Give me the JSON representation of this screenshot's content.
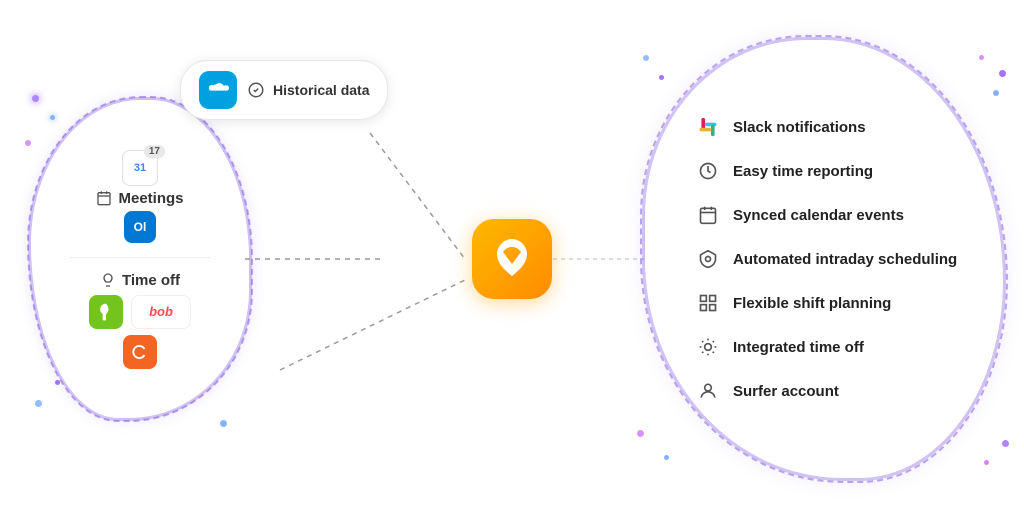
{
  "left": {
    "meetings": {
      "label": "Meetings",
      "badge": "17"
    },
    "timeoff": {
      "label": "Time off"
    }
  },
  "historical": {
    "label": "Historical data"
  },
  "features": [
    {
      "id": "slack-notifications",
      "icon": "slack",
      "text": "Slack notifications"
    },
    {
      "id": "easy-time-reporting",
      "icon": "clock",
      "text": "Easy time reporting"
    },
    {
      "id": "synced-calendar",
      "icon": "calendar",
      "text": "Synced calendar events"
    },
    {
      "id": "automated-intraday",
      "icon": "shield",
      "text": "Automated intraday scheduling"
    },
    {
      "id": "flexible-shift",
      "icon": "grid",
      "text": "Flexible shift planning"
    },
    {
      "id": "integrated-timeoff",
      "icon": "sun",
      "text": "Integrated time off"
    },
    {
      "id": "surfer-account",
      "icon": "user",
      "text": "Surfer account"
    }
  ],
  "colors": {
    "accent": "#8B5CF6",
    "orange": "#FF8C00",
    "blue": "#4285F4"
  }
}
